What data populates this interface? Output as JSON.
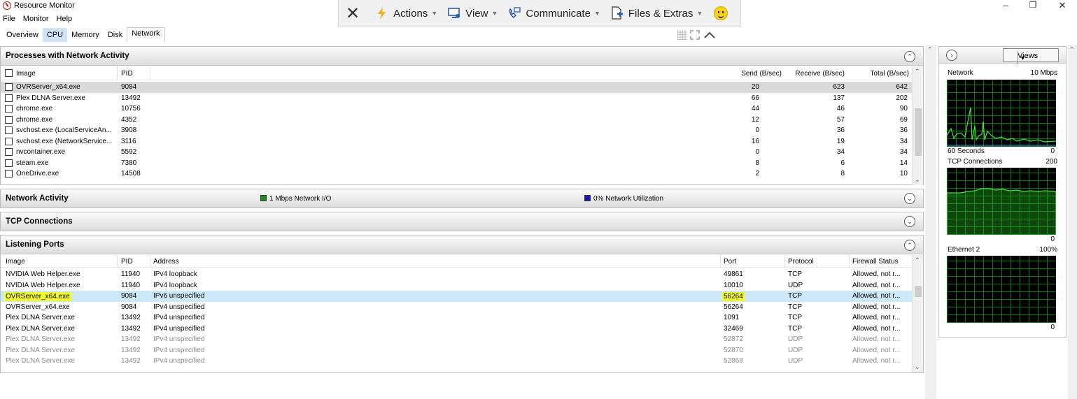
{
  "window": {
    "title": "Resource Monitor",
    "minimize": "–",
    "maximize": "❐",
    "close": "✕"
  },
  "menu": [
    "File",
    "Monitor",
    "Help"
  ],
  "tabs": [
    "Overview",
    "CPU",
    "Memory",
    "Disk",
    "Network"
  ],
  "active_tab": "Network",
  "remote_toolbar": {
    "close": "✕",
    "actions": "Actions",
    "view": "View",
    "communicate": "Communicate",
    "files": "Files & Extras",
    "icons": [
      "close-icon",
      "lightning-icon",
      "monitor-icon",
      "phone-icon",
      "file-icon",
      "smiley-icon"
    ]
  },
  "processes": {
    "title": "Processes with Network Activity",
    "columns": {
      "image": "Image",
      "pid": "PID",
      "send": "Send (B/sec)",
      "receive": "Receive (B/sec)",
      "total": "Total (B/sec)"
    },
    "rows": [
      {
        "image": "OVRServer_x64.exe",
        "pid": "9084",
        "send": "20",
        "receive": "623",
        "total": "642"
      },
      {
        "image": "Plex DLNA Server.exe",
        "pid": "13492",
        "send": "66",
        "receive": "137",
        "total": "202"
      },
      {
        "image": "chrome.exe",
        "pid": "10756",
        "send": "44",
        "receive": "46",
        "total": "90"
      },
      {
        "image": "chrome.exe",
        "pid": "4352",
        "send": "12",
        "receive": "57",
        "total": "69"
      },
      {
        "image": "svchost.exe (LocalServiceAn...",
        "pid": "3908",
        "send": "0",
        "receive": "36",
        "total": "36"
      },
      {
        "image": "svchost.exe (NetworkService...",
        "pid": "3116",
        "send": "16",
        "receive": "19",
        "total": "34"
      },
      {
        "image": "nvcontainer.exe",
        "pid": "5592",
        "send": "0",
        "receive": "34",
        "total": "34"
      },
      {
        "image": "steam.exe",
        "pid": "7380",
        "send": "8",
        "receive": "6",
        "total": "14"
      },
      {
        "image": "OneDrive.exe",
        "pid": "14508",
        "send": "2",
        "receive": "8",
        "total": "10"
      }
    ]
  },
  "network_activity": {
    "title": "Network Activity",
    "io": "1 Mbps Network I/O",
    "util": "0% Network Utilization",
    "io_color": "#1e8c1e",
    "util_color": "#1a1ab4"
  },
  "tcp": {
    "title": "TCP Connections"
  },
  "listening": {
    "title": "Listening Ports",
    "columns": {
      "image": "Image",
      "pid": "PID",
      "address": "Address",
      "port": "Port",
      "protocol": "Protocol",
      "firewall": "Firewall Status"
    },
    "rows": [
      {
        "image": "NVIDIA Web Helper.exe",
        "pid": "11940",
        "address": "IPv4 loopback",
        "port": "49861",
        "protocol": "TCP",
        "firewall": "Allowed, not r..."
      },
      {
        "image": "NVIDIA Web Helper.exe",
        "pid": "11940",
        "address": "IPv4 loopback",
        "port": "10010",
        "protocol": "UDP",
        "firewall": "Allowed, not r..."
      },
      {
        "image": "OVRServer_x64.exe",
        "pid": "9084",
        "address": "IPv6 unspecified",
        "port": "56264",
        "protocol": "TCP",
        "firewall": "Allowed, not r..."
      },
      {
        "image": "OVRServer_x64.exe",
        "pid": "9084",
        "address": "IPv4 unspecified",
        "port": "56264",
        "protocol": "TCP",
        "firewall": "Allowed, not r..."
      },
      {
        "image": "Plex DLNA Server.exe",
        "pid": "13492",
        "address": "IPv4 unspecified",
        "port": "1091",
        "protocol": "TCP",
        "firewall": "Allowed, not r..."
      },
      {
        "image": "Plex DLNA Server.exe",
        "pid": "13492",
        "address": "IPv4 unspecified",
        "port": "32469",
        "protocol": "TCP",
        "firewall": "Allowed, not r..."
      },
      {
        "image": "Plex DLNA Server.exe",
        "pid": "13492",
        "address": "IPv4 unspecified",
        "port": "52872",
        "protocol": "UDP",
        "firewall": "Allowed, not r..."
      },
      {
        "image": "Plex DLNA Server.exe",
        "pid": "13492",
        "address": "IPv4 unspecified",
        "port": "52870",
        "protocol": "UDP",
        "firewall": "Allowed, not r..."
      },
      {
        "image": "Plex DLNA Server.exe",
        "pid": "13492",
        "address": "IPv4 unspecified",
        "port": "52868",
        "protocol": "UDP",
        "firewall": "Allowed, not r..."
      }
    ]
  },
  "right_panel": {
    "views": "Views",
    "network": {
      "label": "Network",
      "max": "10 Mbps",
      "seconds": "60 Seconds",
      "min": "0"
    },
    "tcp": {
      "label": "TCP Connections",
      "max": "200",
      "min": "0"
    },
    "ethernet": {
      "label": "Ethernet 2",
      "max": "100%",
      "min": "0"
    }
  }
}
